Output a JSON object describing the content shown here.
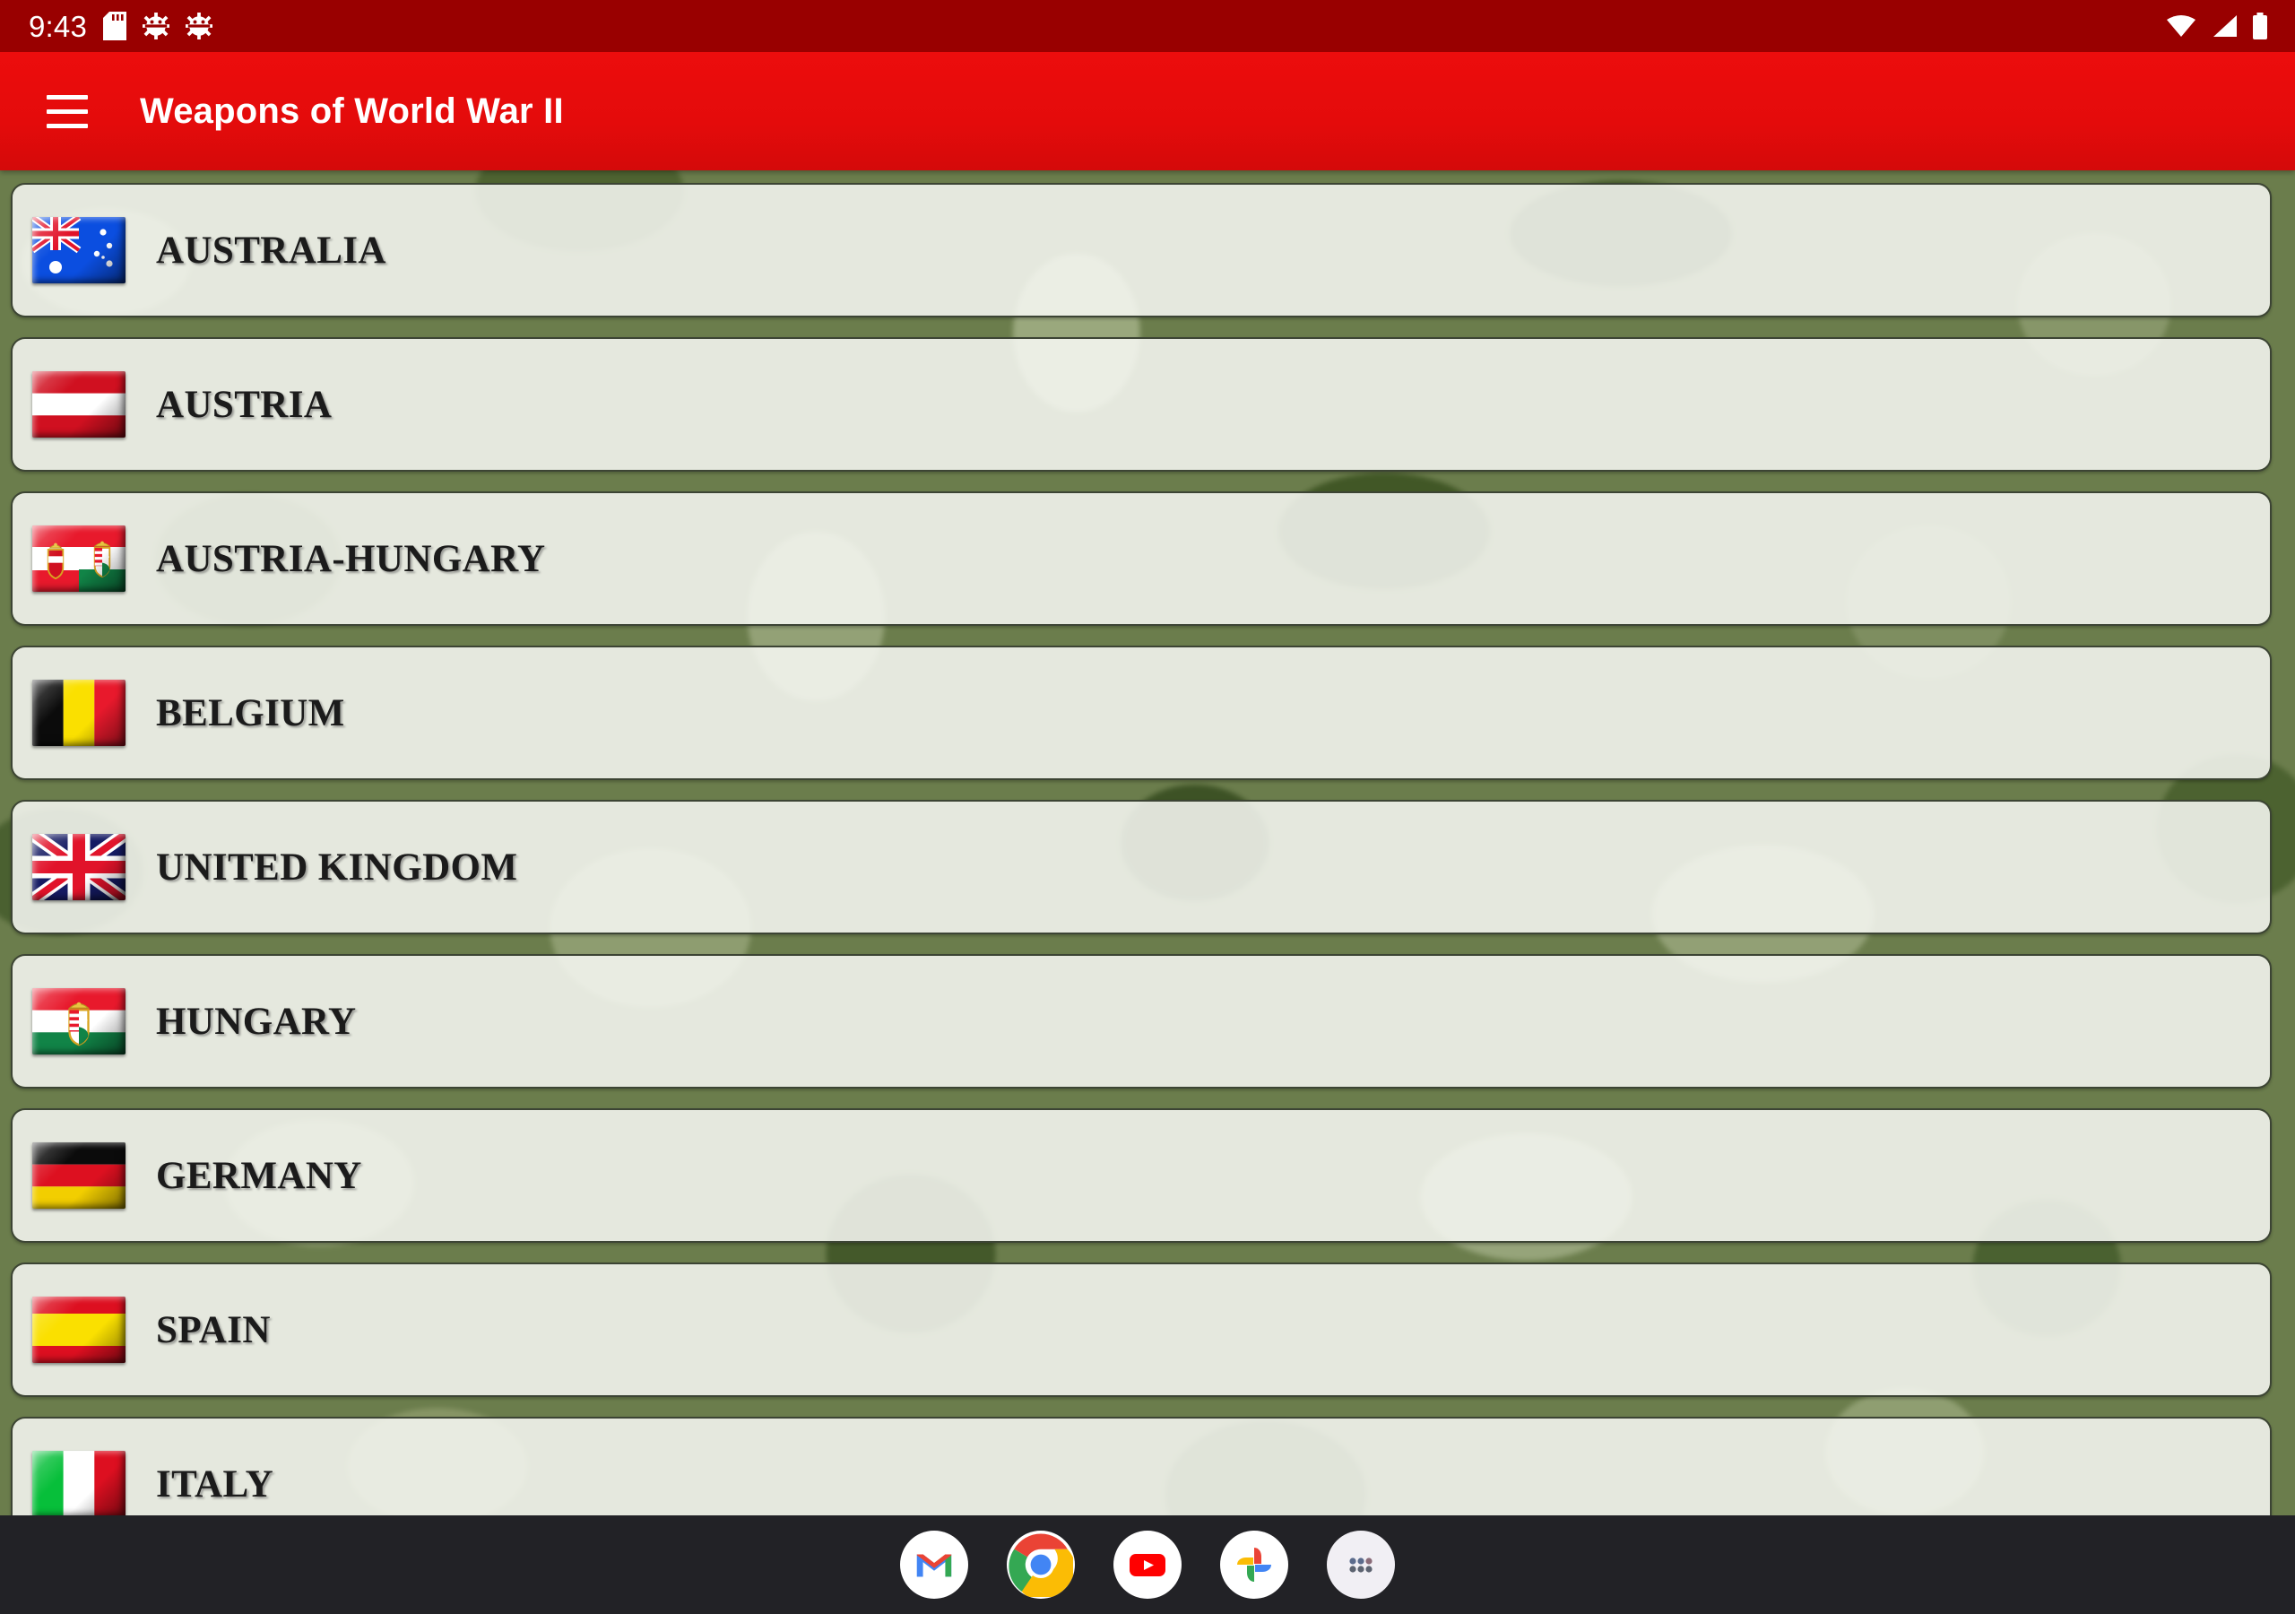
{
  "statusbar": {
    "time": "9:43",
    "icons": [
      "sd-card-icon",
      "gear-icon",
      "gear-icon"
    ],
    "right_icons": [
      "wifi-icon",
      "signal-icon",
      "battery-icon"
    ],
    "bg_color": "#990000"
  },
  "appbar": {
    "menu_icon": "hamburger-menu-icon",
    "title": "Weapons of World War II",
    "bg_color": "#E40B0B",
    "text_color": "#FFFFFF"
  },
  "list": {
    "items": [
      {
        "label": "AUSTRALIA",
        "flag": "australia-flag"
      },
      {
        "label": "AUSTRIA",
        "flag": "austria-flag"
      },
      {
        "label": "AUSTRIA-HUNGARY",
        "flag": "austria-hungary-flag"
      },
      {
        "label": "BELGIUM",
        "flag": "belgium-flag"
      },
      {
        "label": "UNITED KINGDOM",
        "flag": "united-kingdom-flag"
      },
      {
        "label": "HUNGARY",
        "flag": "hungary-flag"
      },
      {
        "label": "GERMANY",
        "flag": "germany-flag"
      },
      {
        "label": "SPAIN",
        "flag": "spain-flag"
      },
      {
        "label": "ITALY",
        "flag": "italy-flag"
      }
    ],
    "card_bg": "#F2F4EE",
    "card_border": "#3C4434",
    "background": "camouflage-green"
  },
  "dock": {
    "bg_color": "#222226",
    "apps": [
      {
        "name": "gmail-icon"
      },
      {
        "name": "chrome-icon"
      },
      {
        "name": "youtube-icon"
      },
      {
        "name": "google-photos-icon"
      },
      {
        "name": "app-drawer-icon"
      }
    ]
  }
}
